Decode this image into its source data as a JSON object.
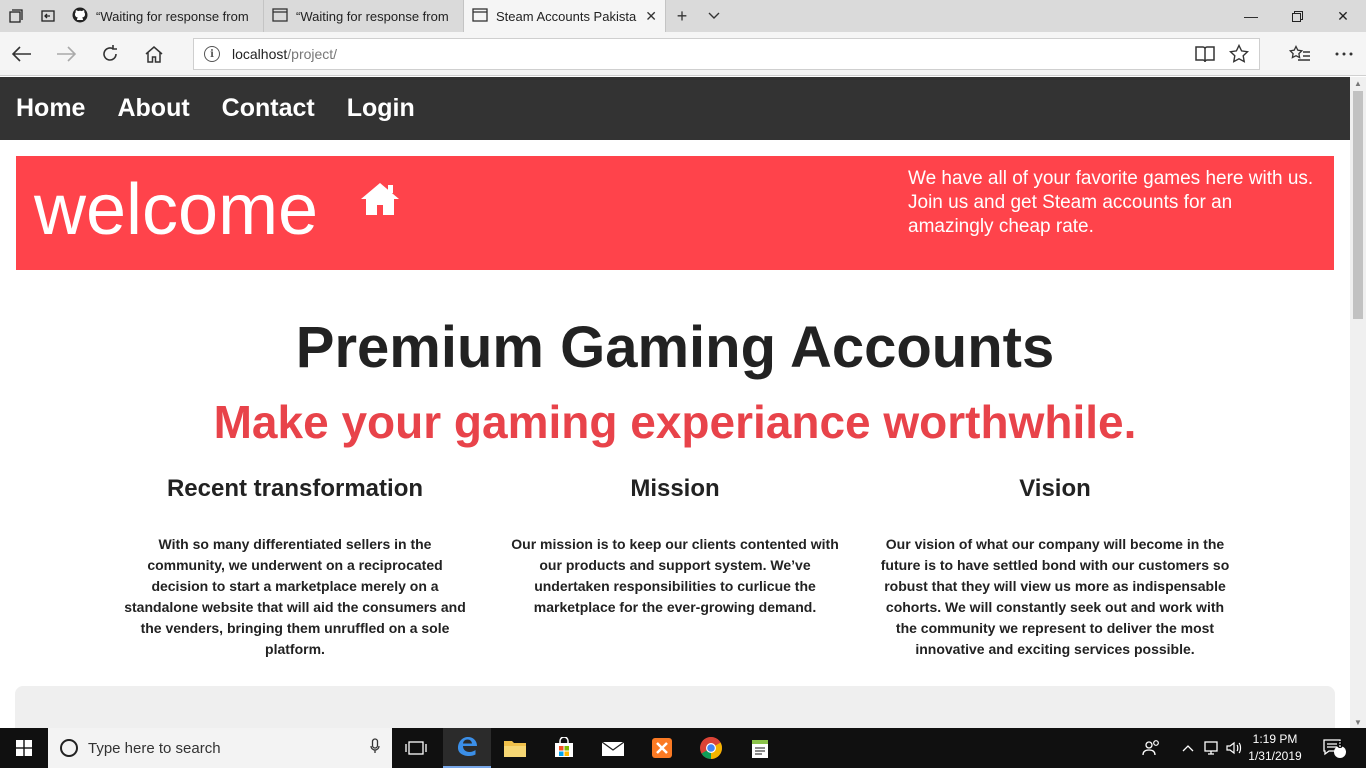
{
  "browser": {
    "tabs": [
      {
        "label": "“Waiting for response from",
        "icon": "github-icon"
      },
      {
        "label": "“Waiting for response from",
        "icon": "page-icon"
      },
      {
        "label": "Steam Accounts Pakista",
        "icon": "page-icon",
        "active": true
      }
    ],
    "address": {
      "host": "localhost",
      "path": "/project/"
    }
  },
  "site": {
    "nav": [
      "Home",
      "About",
      "Contact",
      "Login"
    ],
    "hero": {
      "title": "welcome",
      "text": "We have all of your favorite games here with us. Join us and get Steam accounts for an amazingly cheap rate.",
      "color": "#ff434b"
    },
    "heading": "Premium Gaming Accounts",
    "subheading": "Make your gaming experiance worthwhile.",
    "subheading_color": "#e8434a",
    "columns": [
      {
        "title": "Recent transformation",
        "text": "With so many differentiated sellers in the community, we underwent on a reciprocated decision to start a marketplace merely on a standalone website that will aid the consumers and the venders, bringing them unruffled on a sole platform."
      },
      {
        "title": "Mission",
        "text": "Our mission is to keep our clients contented with our products and support system. We’ve undertaken responsibilities to curlicue the marketplace for the ever-growing demand."
      },
      {
        "title": "Vision",
        "text": "Our vision of what our company will become in the future is to have settled bond with our customers so robust that they will view us more as indispensable cohorts. We will constantly seek out and work with the community we represent to deliver the most innovative and exciting services possible."
      }
    ]
  },
  "taskbar": {
    "search_placeholder": "Type here to search",
    "time": "1:19 PM",
    "date": "1/31/2019",
    "notification_count": "3"
  }
}
